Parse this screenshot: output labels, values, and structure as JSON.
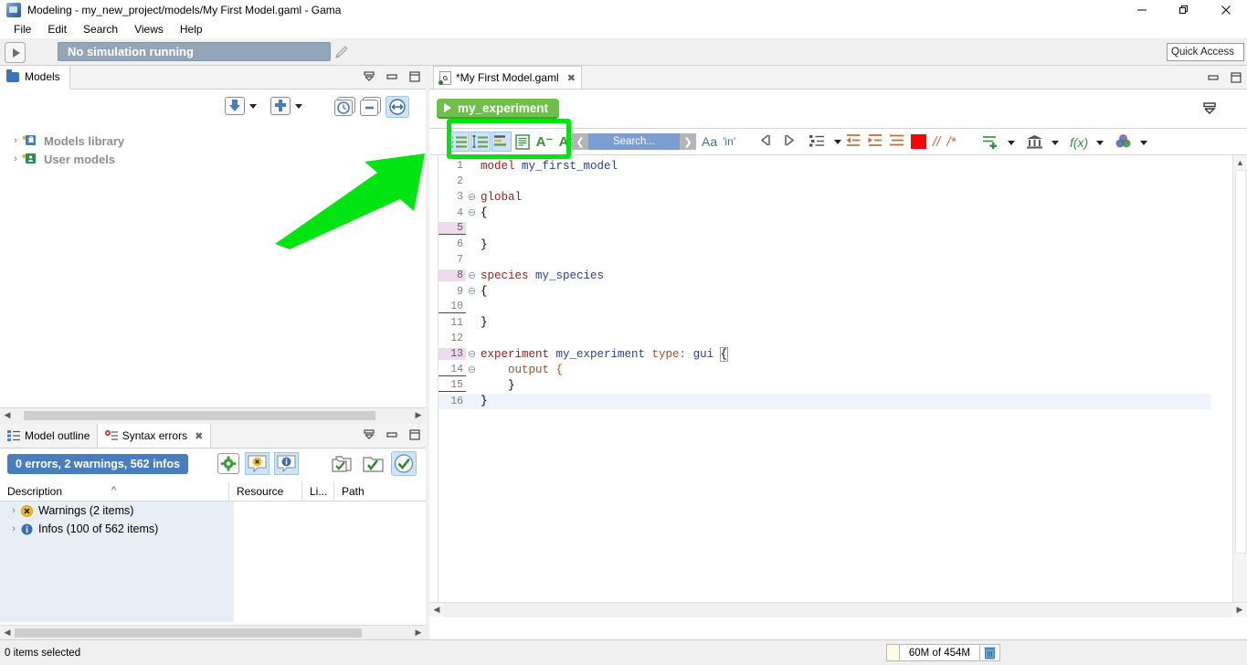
{
  "window": {
    "title": "Modeling - my_new_project/models/My First Model.gaml - Gama",
    "app_icon": "gama-icon",
    "minimize": "—",
    "restore": "❐",
    "close": "✕"
  },
  "menubar": {
    "items": [
      {
        "label": "File"
      },
      {
        "label": "Edit"
      },
      {
        "label": "Search"
      },
      {
        "label": "Views"
      },
      {
        "label": "Help"
      }
    ]
  },
  "simbar": {
    "play_icon": "play-icon",
    "status_text": "No simulation running",
    "pencil_icon": "pencil-icon",
    "quick_access": "Quick Access"
  },
  "models_panel": {
    "tab_label": "Models",
    "tab_icon": "folder-icon",
    "view_controls": [
      {
        "name": "minimize-all-icon"
      },
      {
        "name": "minimize-icon"
      },
      {
        "name": "maximize-icon"
      }
    ],
    "toolbar": [
      {
        "name": "import-model-icon",
        "label": ""
      },
      {
        "name": "import-dropdown-caret",
        "label": ""
      },
      {
        "name": "new-model-icon",
        "label": ""
      },
      {
        "name": "new-dropdown-caret",
        "label": ""
      },
      {
        "name": "history-clock-icon",
        "label": ""
      },
      {
        "name": "collapse-all-icon",
        "label": ""
      },
      {
        "name": "link-sync-icon",
        "label": ""
      }
    ],
    "tree": [
      {
        "twisty": "›",
        "icon": "library-lock-icon",
        "label": "Models library"
      },
      {
        "twisty": "›",
        "icon": "user-models-icon",
        "label": "User models"
      }
    ]
  },
  "errors_panel": {
    "tabs": [
      {
        "label": "Model outline",
        "icon": "outline-icon",
        "active": false,
        "closable": false
      },
      {
        "label": "Syntax errors",
        "icon": "error-icon",
        "active": true,
        "closable": true
      }
    ],
    "view_controls": [
      {
        "name": "minimize-all-icon"
      },
      {
        "name": "minimize-icon"
      },
      {
        "name": "maximize-icon"
      }
    ],
    "summary_badge": "0 errors, 2 warnings, 562 infos",
    "toolbar": [
      {
        "name": "settings-gear-icon",
        "selected": false
      },
      {
        "name": "warnings-filter-icon",
        "selected": true
      },
      {
        "name": "infos-filter-icon",
        "selected": true
      },
      {
        "name": "scope-all-icon",
        "selected": false
      },
      {
        "name": "scope-selection-icon",
        "selected": false
      },
      {
        "name": "scope-active-icon",
        "selected": true
      }
    ],
    "columns": [
      {
        "label": "Description",
        "sort": "^"
      },
      {
        "label": "Resource"
      },
      {
        "label": "Li..."
      },
      {
        "label": "Path"
      }
    ],
    "rows": [
      {
        "twisty": "›",
        "icon": "warning-icon",
        "label": "Warnings (2 items)"
      },
      {
        "twisty": "›",
        "icon": "info-icon",
        "label": "Infos (100 of 562 items)"
      }
    ]
  },
  "editor": {
    "tab": {
      "label": "*My First Model.gaml",
      "icon": "gaml-file-icon",
      "close": "✖"
    },
    "view_controls": [
      {
        "name": "minimize-icon"
      },
      {
        "name": "maximize-icon"
      }
    ],
    "experiment_button": "my_experiment",
    "experiment_play_icon": "play-triangle-icon",
    "right_toolbar_icon": "minimize-all-icon",
    "toolbar_group_highlighted": [
      {
        "name": "line-numbers-icon",
        "selected": true
      },
      {
        "name": "folding-icon",
        "selected": true
      },
      {
        "name": "markers-icon",
        "selected": true
      },
      {
        "name": "word-wrap-icon",
        "selected": false
      },
      {
        "name": "font-decrease-icon",
        "label": "A⁻",
        "selected": false
      },
      {
        "name": "font-increase-icon",
        "label": "A⁺",
        "selected": false
      }
    ],
    "search": {
      "prev_icon": "❮",
      "placeholder": "Search...",
      "next_icon": "❯",
      "case_icon": "Aa",
      "whole_word_icon": "'in'"
    },
    "nav_toolbar": [
      {
        "name": "back-arrow-icon"
      },
      {
        "name": "forward-arrow-icon"
      },
      {
        "name": "outline-list-icon"
      },
      {
        "name": "outline-caret-icon"
      }
    ],
    "format_toolbar": [
      {
        "name": "outdent-icon"
      },
      {
        "name": "indent-icon"
      },
      {
        "name": "format-lines-icon"
      },
      {
        "name": "color-swatch-icon",
        "color": "#ff0000"
      },
      {
        "name": "line-comment-icon",
        "label": "//"
      },
      {
        "name": "block-comment-icon",
        "label": "/*"
      },
      {
        "name": "add-template-icon"
      },
      {
        "name": "add-template-caret"
      },
      {
        "name": "builtin-types-icon"
      },
      {
        "name": "builtin-types-caret"
      },
      {
        "name": "functions-icon",
        "label": "f(x)"
      },
      {
        "name": "functions-caret"
      },
      {
        "name": "colors-icon"
      },
      {
        "name": "colors-caret"
      }
    ],
    "code": [
      {
        "num": "1",
        "fold": "",
        "marked": false,
        "underline": false,
        "current": false,
        "tokens": [
          {
            "t": "model ",
            "c": "kw"
          },
          {
            "t": "my_first_model",
            "c": "id"
          }
        ]
      },
      {
        "num": "2",
        "fold": "",
        "marked": false,
        "underline": false,
        "current": false,
        "tokens": []
      },
      {
        "num": "3",
        "fold": "⊖",
        "marked": false,
        "underline": false,
        "current": false,
        "tokens": [
          {
            "t": "global",
            "c": "kw"
          }
        ]
      },
      {
        "num": "4",
        "fold": "⊖",
        "marked": false,
        "underline": false,
        "current": false,
        "tokens": [
          {
            "t": "{",
            "c": "pl"
          }
        ]
      },
      {
        "num": "5",
        "fold": "",
        "marked": true,
        "underline": true,
        "current": false,
        "tokens": []
      },
      {
        "num": "6",
        "fold": "",
        "marked": false,
        "underline": false,
        "current": false,
        "tokens": [
          {
            "t": "}",
            "c": "pl"
          }
        ]
      },
      {
        "num": "7",
        "fold": "",
        "marked": false,
        "underline": false,
        "current": false,
        "tokens": []
      },
      {
        "num": "8",
        "fold": "⊖",
        "marked": true,
        "underline": false,
        "current": false,
        "tokens": [
          {
            "t": "species ",
            "c": "kw"
          },
          {
            "t": "my_species",
            "c": "id"
          }
        ]
      },
      {
        "num": "9",
        "fold": "⊖",
        "marked": false,
        "underline": false,
        "current": false,
        "tokens": [
          {
            "t": "{",
            "c": "pl"
          }
        ]
      },
      {
        "num": "10",
        "fold": "",
        "marked": false,
        "underline": true,
        "current": false,
        "tokens": []
      },
      {
        "num": "11",
        "fold": "",
        "marked": false,
        "underline": false,
        "current": false,
        "tokens": [
          {
            "t": "}",
            "c": "pl"
          }
        ]
      },
      {
        "num": "12",
        "fold": "",
        "marked": false,
        "underline": false,
        "current": false,
        "tokens": []
      },
      {
        "num": "13",
        "fold": "⊖",
        "marked": true,
        "underline": false,
        "current": false,
        "tokens": [
          {
            "t": "experiment ",
            "c": "kw"
          },
          {
            "t": "my_experiment ",
            "c": "id"
          },
          {
            "t": "type: ",
            "c": "attr"
          },
          {
            "t": "gui ",
            "c": "id"
          },
          {
            "t": "{",
            "c": "pl"
          }
        ]
      },
      {
        "num": "14",
        "fold": "⊖",
        "marked": false,
        "underline": true,
        "current": false,
        "tokens": [
          {
            "t": "    output {",
            "c": "attr"
          }
        ]
      },
      {
        "num": "15",
        "fold": "",
        "marked": false,
        "underline": true,
        "current": false,
        "tokens": [
          {
            "t": "    }",
            "c": "pl"
          }
        ]
      },
      {
        "num": "16",
        "fold": "",
        "marked": false,
        "underline": false,
        "current": true,
        "tokens": [
          {
            "t": "}",
            "c": "pl"
          }
        ]
      }
    ]
  },
  "statusbar": {
    "selection_text": "0 items selected",
    "memory_text": "60M of 454M",
    "trash_icon": "trash-icon"
  },
  "annotation": {
    "arrow_color": "#00e512",
    "highlight_color": "#00e512",
    "target": "editor-toolbar-display-group"
  }
}
